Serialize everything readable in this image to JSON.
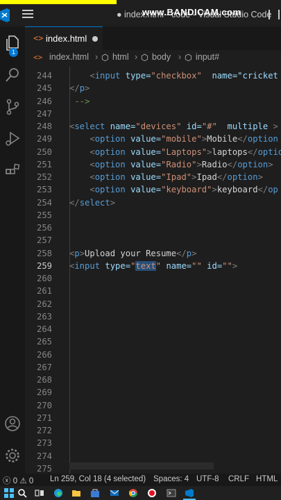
{
  "title_bar": {
    "title": "● index.html - code - Visual Studio Code",
    "watermark": "www.BANDICAM.com"
  },
  "activity_bar": {
    "items": [
      {
        "icon": "explorer-icon",
        "badge": "1"
      },
      {
        "icon": "search-icon"
      },
      {
        "icon": "source-control-icon"
      },
      {
        "icon": "run-debug-icon"
      },
      {
        "icon": "extensions-icon"
      },
      {
        "icon": "account-icon"
      },
      {
        "icon": "settings-gear-icon"
      }
    ]
  },
  "tabs": [
    {
      "icon_text": "<>",
      "label": "index.html",
      "modified": true
    }
  ],
  "breadcrumb": {
    "file": "index.html",
    "items": [
      "html",
      "body",
      "input#"
    ]
  },
  "editor": {
    "current_line": "259",
    "lines": [
      {
        "n": "244",
        "text": "    <input type=\"checkbox\"  name=\"cricket"
      },
      {
        "n": "245",
        "text": "</p>"
      },
      {
        "n": "246",
        "text": " -->"
      },
      {
        "n": "247",
        "text": ""
      },
      {
        "n": "248",
        "text": "<select name=\"devices\" id=\"#\"  multiple >"
      },
      {
        "n": "249",
        "text": "    <option value=\"mobile\">Mobile</option"
      },
      {
        "n": "250",
        "text": "    <option value=\"Laptops\">laptops</optio"
      },
      {
        "n": "251",
        "text": "    <option value=\"Radio\">Radio</option>"
      },
      {
        "n": "252",
        "text": "    <option value=\"Ipad\">Ipad</option>"
      },
      {
        "n": "253",
        "text": "    <option value=\"keyboard\">keyboard</op"
      },
      {
        "n": "254",
        "text": "</select>"
      },
      {
        "n": "255",
        "text": ""
      },
      {
        "n": "256",
        "text": ""
      },
      {
        "n": "257",
        "text": ""
      },
      {
        "n": "258",
        "text": "<p>Upload your Resume</p>"
      },
      {
        "n": "259",
        "text": "<input type=\"text\" name=\"\" id=\"\">"
      },
      {
        "n": "260",
        "text": ""
      },
      {
        "n": "261",
        "text": ""
      },
      {
        "n": "262",
        "text": ""
      },
      {
        "n": "263",
        "text": ""
      },
      {
        "n": "264",
        "text": ""
      },
      {
        "n": "265",
        "text": ""
      },
      {
        "n": "266",
        "text": ""
      },
      {
        "n": "267",
        "text": ""
      },
      {
        "n": "268",
        "text": ""
      },
      {
        "n": "269",
        "text": ""
      },
      {
        "n": "270",
        "text": ""
      },
      {
        "n": "271",
        "text": ""
      },
      {
        "n": "272",
        "text": ""
      },
      {
        "n": "273",
        "text": ""
      },
      {
        "n": "274",
        "text": ""
      },
      {
        "n": "275",
        "text": ""
      }
    ]
  },
  "status_bar": {
    "errors": "0",
    "warnings": "0",
    "position": "Ln 259, Col 18 (4 selected)",
    "spaces": "Spaces: 4",
    "encoding": "UTF-8",
    "eol": "CRLF",
    "language": "HTML"
  },
  "taskbar": {
    "items": [
      "windows-start-icon",
      "search-icon",
      "task-view-icon",
      "edge-icon",
      "file-explorer-icon",
      "chrome-icon",
      "record-icon",
      "terminal-icon",
      "vscode-icon"
    ]
  },
  "colors": {
    "accent": "#0078d4",
    "watermark_strip": "#ffff00",
    "editor_bg": "#1e1e1e"
  }
}
